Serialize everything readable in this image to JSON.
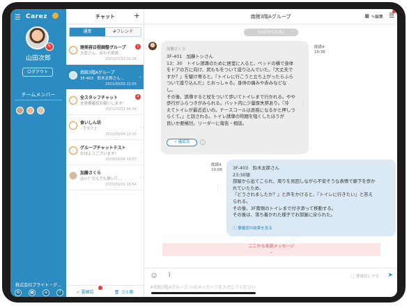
{
  "sidebar": {
    "logo": "Carez",
    "user_name": "山田次郎",
    "logout_label": "ログアウト",
    "team_label": "チームメンバー",
    "company": "株式会社ブライト・グ..."
  },
  "list": {
    "title": "チャット",
    "add_label": "+",
    "tabs": [
      {
        "label": "通常",
        "active": true
      },
      {
        "label": "#フレンド",
        "active": false
      }
    ],
    "items": [
      {
        "name": "理美容日程調整グループ",
        "preview": "大宮さん、合わが恵規...",
        "date": "2021/03/19 02:26",
        "badge": "1"
      },
      {
        "name": "南館3階Aグループ",
        "preview": "3F-403　鈴木太郎さん...",
        "date": "2021/03/03 21:55",
        "badge": ""
      },
      {
        "name": "全スタッフチャット",
        "preview": "全員要確認お願いします！",
        "date": "2021/03/01 06:34",
        "badge": "4"
      },
      {
        "name": "食いしん坊",
        "preview": "- テスト2",
        "date": "2020/09/04 22:10",
        "badge": ""
      },
      {
        "name": "グループチャットテスト",
        "preview": "おはようございます！",
        "date": "2020/09/04 16:07",
        "badge": ""
      },
      {
        "name": "加藤さくら",
        "preview": "はい！なんでも質いて...",
        "date": "2020/09/01 16:54",
        "badge": ""
      }
    ],
    "footer": {
      "check_label": "要確認",
      "trash_label": "ゴミ箱"
    }
  },
  "main": {
    "title": "南館3階Aグループ",
    "edit_label": "編集",
    "date_pill": "03/03/10(水)",
    "message1": {
      "sender": "加藤さくら",
      "reader": "既読4",
      "time": "16:38",
      "lines": [
        "3F-401　加藤トシさん",
        "13：30　トイレ誘導のために居室に入ると、ベッドの横で身体",
        "をドアの方に向け、尻ももをついて座り込んでいた。『大丈夫で",
        "すか？』を駆け寄ると、『トイレに行こうと立ち上がったらふら",
        "ついて座り込んだ』とおっしゃる。身体の痛みや赤みなどな",
        "し。",
        "その後、誘導すると杖をついて歩いてトイレまで行かれる。やや",
        "歩行がふらつきがみられる。バット内に少量尿失禁あり。『冷",
        "えてトイレが最近近いの。ナースコールは逐惑になるかと押しづ",
        "らくて。』と話される。トイレ誘導の時間を短くしたほうが",
        "良いか要検討。リーダーに報告・相談。"
      ],
      "check_label": "確認済",
      "info_label": "i"
    },
    "message2": {
      "reader": "既読4",
      "time": "10:08",
      "lines": [
        "3F-403　鈴木太郎さん",
        "23:30頃",
        "部屋から出てこられ、周りを見回しながら不安そうな表情で廊下を歩か",
        "れていたため、",
        "『どうされましたか？』と声をかけると、『トイレに行きたい』と答え",
        "られる。",
        "その後、3F南側のトイレまで付き添って移動する。",
        "その後は、落ち着かれた様子でお部屋に戻られた。"
      ],
      "result_label": "要確認の結果を見る"
    },
    "unread_label": "ここから未読メッセージ",
    "input": {
      "placeholder": "#南館3階Aグループ へのメッセージを入力してください",
      "request_label": "要確認にする"
    }
  },
  "colors": {
    "accent": "#2c8cc2",
    "alert": "#e53d3d",
    "unread_bg": "#fbe5e5",
    "self_bubble": "#dbe9f5"
  }
}
